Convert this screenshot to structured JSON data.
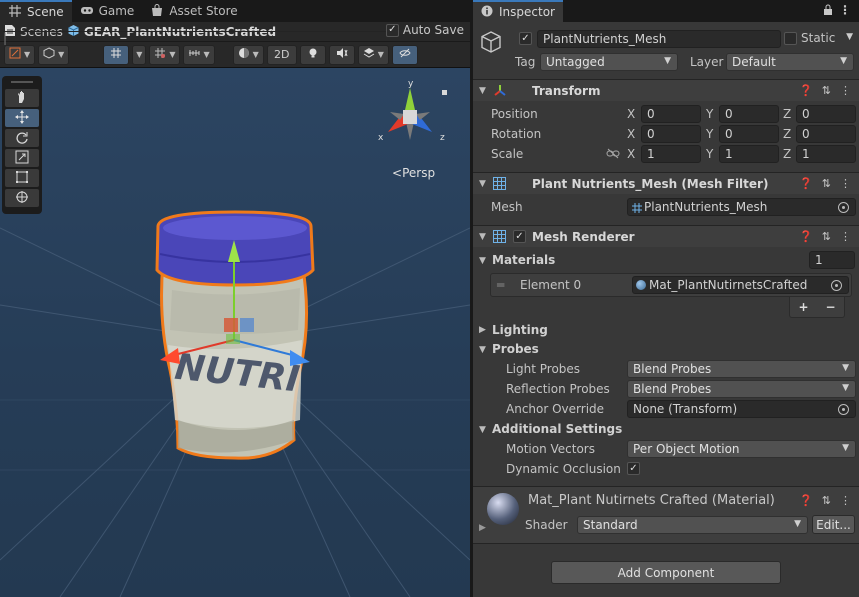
{
  "tabs": [
    {
      "label": "Scene"
    },
    {
      "label": "Game"
    },
    {
      "label": "Asset Store"
    }
  ],
  "breadcrumb": {
    "root": "Scenes",
    "current": "GEAR_PlantNutrientsCrafted"
  },
  "autosave": {
    "label": "Auto Save",
    "checked": true
  },
  "scene_toolbar": {
    "mode_2d": "2D"
  },
  "viewport": {
    "projection": "Persp",
    "jar_label": "NUTRI"
  },
  "gizmo": {
    "y": "y",
    "x": "x",
    "z": "z"
  },
  "inspector": {
    "tab_label": "Inspector",
    "object": {
      "active": true,
      "name": "PlantNutrients_Mesh",
      "static_label": "Static",
      "tag_label": "Tag",
      "tag_value": "Untagged",
      "layer_label": "Layer",
      "layer_value": "Default"
    },
    "transform": {
      "title": "Transform",
      "rows": [
        {
          "label": "Position",
          "x": "0",
          "y": "0",
          "z": "0"
        },
        {
          "label": "Rotation",
          "x": "0",
          "y": "0",
          "z": "0"
        },
        {
          "label": "Scale",
          "x": "1",
          "y": "1",
          "z": "1"
        }
      ],
      "axis_x": "X",
      "axis_y": "Y",
      "axis_z": "Z"
    },
    "mesh_filter": {
      "title": "Plant Nutrients_Mesh (Mesh Filter)",
      "mesh_label": "Mesh",
      "mesh_value": "PlantNutrients_Mesh"
    },
    "mesh_renderer": {
      "title": "Mesh Renderer",
      "enabled": true,
      "materials_label": "Materials",
      "materials_count": "1",
      "element_label": "Element 0",
      "element_value": "Mat_PlantNutirnetsCrafted",
      "add": "+",
      "remove": "−",
      "lighting_label": "Lighting",
      "probes_label": "Probes",
      "light_probes_label": "Light Probes",
      "light_probes_value": "Blend Probes",
      "reflection_probes_label": "Reflection Probes",
      "reflection_probes_value": "Blend Probes",
      "anchor_label": "Anchor Override",
      "anchor_value": "None (Transform)",
      "additional_label": "Additional Settings",
      "motion_label": "Motion Vectors",
      "motion_value": "Per Object Motion",
      "occlusion_label": "Dynamic Occlusion",
      "occlusion_checked": true
    },
    "material": {
      "title": "Mat_Plant Nutirnets Crafted (Material)",
      "shader_label": "Shader",
      "shader_value": "Standard",
      "edit_label": "Edit..."
    },
    "add_component": "Add Component"
  },
  "colors": {
    "accent": "#3a79bb",
    "selection_outline": "#f07a1a",
    "lid": "#4a46b8",
    "viewport": "#2c4562"
  }
}
